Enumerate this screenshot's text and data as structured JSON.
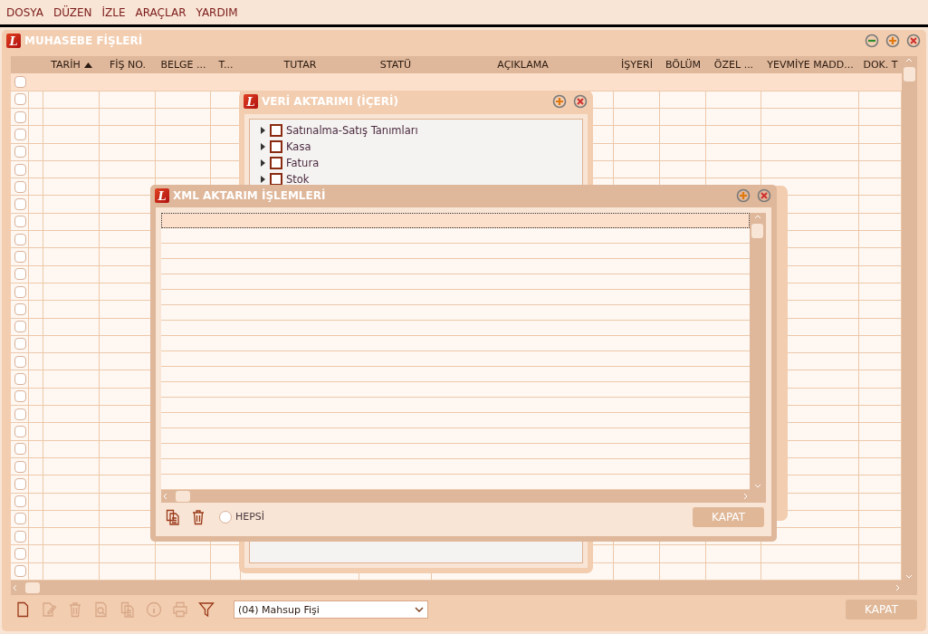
{
  "menu": [
    "DOSYA",
    "DÜZEN",
    "İZLE",
    "ARAÇLAR",
    "YARDIM"
  ],
  "main_window": {
    "logo": "L",
    "title": "MUHASEBE FİŞLERİ",
    "controls": [
      {
        "kind": "minimize"
      },
      {
        "kind": "maximize"
      },
      {
        "kind": "close"
      }
    ],
    "table": {
      "columns": [
        {
          "label": "TARİH",
          "sorted": true
        },
        {
          "label": "FİŞ NO.",
          "sorted": false
        },
        {
          "label": "BELGE ...",
          "sorted": false
        },
        {
          "label": "T...",
          "sorted": false
        },
        {
          "label": "TUTAR",
          "sorted": false
        },
        {
          "label": "STATÜ",
          "sorted": false
        },
        {
          "label": "AÇIKLAMA",
          "sorted": false
        },
        {
          "label": "İŞYERİ",
          "sorted": false
        },
        {
          "label": "BÖLÜM",
          "sorted": false
        },
        {
          "label": "ÖZEL ...",
          "sorted": false
        },
        {
          "label": "YEVMİYE MADD...",
          "sorted": false
        },
        {
          "label": "DOK. T",
          "sorted": false
        }
      ],
      "rows": [
        {
          "checked": false,
          "selected": true
        },
        {
          "checked": false,
          "selected": false
        },
        {
          "checked": false,
          "selected": false
        },
        {
          "checked": false,
          "selected": false
        },
        {
          "checked": false,
          "selected": false
        },
        {
          "checked": false,
          "selected": false
        },
        {
          "checked": false,
          "selected": false
        },
        {
          "checked": false,
          "selected": false
        },
        {
          "checked": false,
          "selected": false
        },
        {
          "checked": false,
          "selected": false
        },
        {
          "checked": false,
          "selected": false
        },
        {
          "checked": false,
          "selected": false
        },
        {
          "checked": false,
          "selected": false
        },
        {
          "checked": false,
          "selected": false
        },
        {
          "checked": false,
          "selected": false
        },
        {
          "checked": false,
          "selected": false
        },
        {
          "checked": false,
          "selected": false
        },
        {
          "checked": false,
          "selected": false
        },
        {
          "checked": false,
          "selected": false
        },
        {
          "checked": false,
          "selected": false
        },
        {
          "checked": false,
          "selected": false
        },
        {
          "checked": false,
          "selected": false
        },
        {
          "checked": false,
          "selected": false
        },
        {
          "checked": false,
          "selected": false
        },
        {
          "checked": false,
          "selected": false
        },
        {
          "checked": false,
          "selected": false
        },
        {
          "checked": false,
          "selected": false
        },
        {
          "checked": false,
          "selected": false
        },
        {
          "checked": false,
          "selected": false
        }
      ]
    },
    "toolbar": [
      {
        "kind": "new",
        "disabled": false
      },
      {
        "kind": "edit",
        "disabled": true
      },
      {
        "kind": "delete",
        "disabled": true
      },
      {
        "kind": "preview",
        "disabled": true
      },
      {
        "kind": "copy",
        "disabled": true
      },
      {
        "kind": "info",
        "disabled": true
      },
      {
        "kind": "print",
        "disabled": true
      },
      {
        "kind": "filter",
        "disabled": false
      }
    ],
    "type_select": {
      "value": "(04) Mahsup Fişi"
    },
    "close_button": "KAPAT"
  },
  "import_window": {
    "logo": "L",
    "title": "VERİ AKTARIMI (İÇERİ)",
    "controls": [
      {
        "kind": "maximize"
      },
      {
        "kind": "close"
      }
    ],
    "tree": [
      {
        "label": "Satınalma-Satış Tanımları",
        "checked": false,
        "expanded": false
      },
      {
        "label": "Kasa",
        "checked": false,
        "expanded": false
      },
      {
        "label": "Fatura",
        "checked": false,
        "expanded": false
      },
      {
        "label": "Stok",
        "checked": false,
        "expanded": false
      }
    ]
  },
  "xml_window": {
    "logo": "L",
    "title": "XML AKTARIM İŞLEMLERİ",
    "controls": [
      {
        "kind": "maximize"
      },
      {
        "kind": "close"
      }
    ],
    "rows": [
      {
        "selected": true
      },
      {
        "selected": false
      },
      {
        "selected": false
      },
      {
        "selected": false
      },
      {
        "selected": false
      },
      {
        "selected": false
      },
      {
        "selected": false
      },
      {
        "selected": false
      },
      {
        "selected": false
      },
      {
        "selected": false
      },
      {
        "selected": false
      },
      {
        "selected": false
      },
      {
        "selected": false
      },
      {
        "selected": false
      },
      {
        "selected": false
      },
      {
        "selected": false
      },
      {
        "selected": false
      },
      {
        "selected": false
      }
    ],
    "tools": [
      {
        "kind": "copy",
        "disabled": false
      },
      {
        "kind": "delete",
        "disabled": false
      }
    ],
    "select_all": {
      "label": "HEPSİ",
      "checked": false
    },
    "close_button": "KAPAT"
  }
}
